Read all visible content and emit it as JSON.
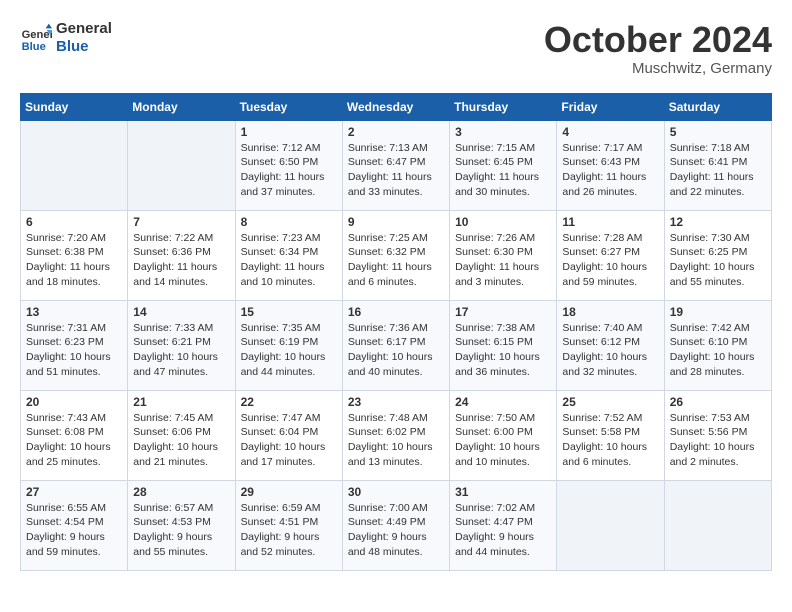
{
  "header": {
    "logo_line1": "General",
    "logo_line2": "Blue",
    "month": "October 2024",
    "location": "Muschwitz, Germany"
  },
  "weekdays": [
    "Sunday",
    "Monday",
    "Tuesday",
    "Wednesday",
    "Thursday",
    "Friday",
    "Saturday"
  ],
  "weeks": [
    [
      {
        "day": "",
        "empty": true
      },
      {
        "day": "",
        "empty": true
      },
      {
        "day": "1",
        "sunrise": "7:12 AM",
        "sunset": "6:50 PM",
        "daylight": "11 hours and 37 minutes."
      },
      {
        "day": "2",
        "sunrise": "7:13 AM",
        "sunset": "6:47 PM",
        "daylight": "11 hours and 33 minutes."
      },
      {
        "day": "3",
        "sunrise": "7:15 AM",
        "sunset": "6:45 PM",
        "daylight": "11 hours and 30 minutes."
      },
      {
        "day": "4",
        "sunrise": "7:17 AM",
        "sunset": "6:43 PM",
        "daylight": "11 hours and 26 minutes."
      },
      {
        "day": "5",
        "sunrise": "7:18 AM",
        "sunset": "6:41 PM",
        "daylight": "11 hours and 22 minutes."
      }
    ],
    [
      {
        "day": "6",
        "sunrise": "7:20 AM",
        "sunset": "6:38 PM",
        "daylight": "11 hours and 18 minutes."
      },
      {
        "day": "7",
        "sunrise": "7:22 AM",
        "sunset": "6:36 PM",
        "daylight": "11 hours and 14 minutes."
      },
      {
        "day": "8",
        "sunrise": "7:23 AM",
        "sunset": "6:34 PM",
        "daylight": "11 hours and 10 minutes."
      },
      {
        "day": "9",
        "sunrise": "7:25 AM",
        "sunset": "6:32 PM",
        "daylight": "11 hours and 6 minutes."
      },
      {
        "day": "10",
        "sunrise": "7:26 AM",
        "sunset": "6:30 PM",
        "daylight": "11 hours and 3 minutes."
      },
      {
        "day": "11",
        "sunrise": "7:28 AM",
        "sunset": "6:27 PM",
        "daylight": "10 hours and 59 minutes."
      },
      {
        "day": "12",
        "sunrise": "7:30 AM",
        "sunset": "6:25 PM",
        "daylight": "10 hours and 55 minutes."
      }
    ],
    [
      {
        "day": "13",
        "sunrise": "7:31 AM",
        "sunset": "6:23 PM",
        "daylight": "10 hours and 51 minutes."
      },
      {
        "day": "14",
        "sunrise": "7:33 AM",
        "sunset": "6:21 PM",
        "daylight": "10 hours and 47 minutes."
      },
      {
        "day": "15",
        "sunrise": "7:35 AM",
        "sunset": "6:19 PM",
        "daylight": "10 hours and 44 minutes."
      },
      {
        "day": "16",
        "sunrise": "7:36 AM",
        "sunset": "6:17 PM",
        "daylight": "10 hours and 40 minutes."
      },
      {
        "day": "17",
        "sunrise": "7:38 AM",
        "sunset": "6:15 PM",
        "daylight": "10 hours and 36 minutes."
      },
      {
        "day": "18",
        "sunrise": "7:40 AM",
        "sunset": "6:12 PM",
        "daylight": "10 hours and 32 minutes."
      },
      {
        "day": "19",
        "sunrise": "7:42 AM",
        "sunset": "6:10 PM",
        "daylight": "10 hours and 28 minutes."
      }
    ],
    [
      {
        "day": "20",
        "sunrise": "7:43 AM",
        "sunset": "6:08 PM",
        "daylight": "10 hours and 25 minutes."
      },
      {
        "day": "21",
        "sunrise": "7:45 AM",
        "sunset": "6:06 PM",
        "daylight": "10 hours and 21 minutes."
      },
      {
        "day": "22",
        "sunrise": "7:47 AM",
        "sunset": "6:04 PM",
        "daylight": "10 hours and 17 minutes."
      },
      {
        "day": "23",
        "sunrise": "7:48 AM",
        "sunset": "6:02 PM",
        "daylight": "10 hours and 13 minutes."
      },
      {
        "day": "24",
        "sunrise": "7:50 AM",
        "sunset": "6:00 PM",
        "daylight": "10 hours and 10 minutes."
      },
      {
        "day": "25",
        "sunrise": "7:52 AM",
        "sunset": "5:58 PM",
        "daylight": "10 hours and 6 minutes."
      },
      {
        "day": "26",
        "sunrise": "7:53 AM",
        "sunset": "5:56 PM",
        "daylight": "10 hours and 2 minutes."
      }
    ],
    [
      {
        "day": "27",
        "sunrise": "6:55 AM",
        "sunset": "4:54 PM",
        "daylight": "9 hours and 59 minutes."
      },
      {
        "day": "28",
        "sunrise": "6:57 AM",
        "sunset": "4:53 PM",
        "daylight": "9 hours and 55 minutes."
      },
      {
        "day": "29",
        "sunrise": "6:59 AM",
        "sunset": "4:51 PM",
        "daylight": "9 hours and 52 minutes."
      },
      {
        "day": "30",
        "sunrise": "7:00 AM",
        "sunset": "4:49 PM",
        "daylight": "9 hours and 48 minutes."
      },
      {
        "day": "31",
        "sunrise": "7:02 AM",
        "sunset": "4:47 PM",
        "daylight": "9 hours and 44 minutes."
      },
      {
        "day": "",
        "empty": true
      },
      {
        "day": "",
        "empty": true
      }
    ]
  ]
}
